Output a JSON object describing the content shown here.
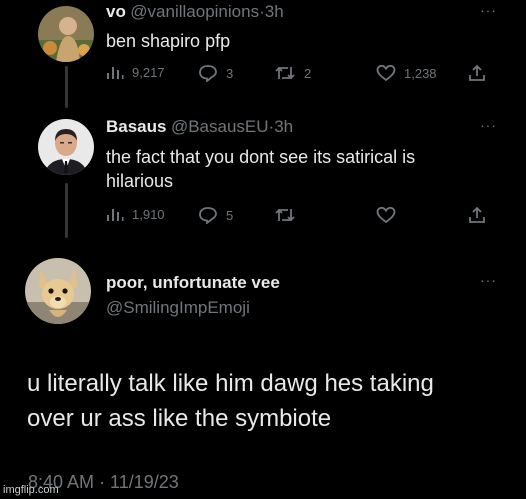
{
  "tweets": [
    {
      "display_name": "vo",
      "handle": "@vanillaopinions",
      "time": "3h",
      "text": "ben shapiro pfp",
      "views": "9,217",
      "replies": "3",
      "retweets": "2",
      "likes": "1,238"
    },
    {
      "display_name": "Basaus",
      "handle": "@BasausEU",
      "time": "3h",
      "text_lines": [
        "the fact that you dont see its satirical is",
        "hilarious"
      ],
      "views": "1,910",
      "replies": "5",
      "retweets": "",
      "likes": ""
    }
  ],
  "main": {
    "display_name": "poor, unfortunate vee",
    "handle": "@SmilingImpEmoji",
    "text_lines": [
      "u literally talk like him dawg hes taking",
      "over ur ass like the symbiote"
    ],
    "timestamp": "8:40 AM · 11/19/23"
  },
  "more_glyph": "···",
  "separator": "·",
  "watermark": "imgflip.com",
  "colors": {
    "background": "#000000",
    "text": "#e7e9ea",
    "muted": "#71767b"
  }
}
